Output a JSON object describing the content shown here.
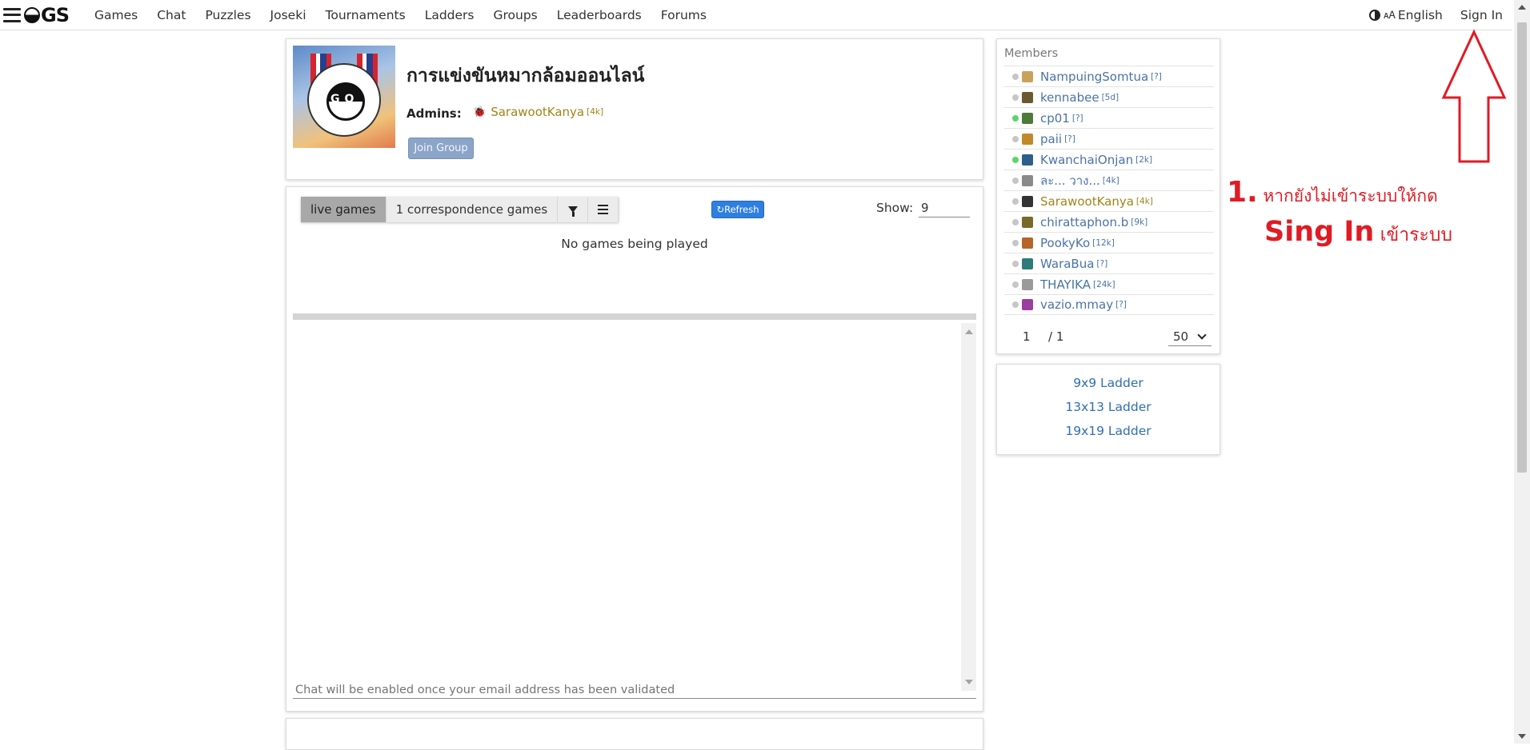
{
  "nav": {
    "logo_text": "GS",
    "links": [
      "Games",
      "Chat",
      "Puzzles",
      "Joseki",
      "Tournaments",
      "Ladders",
      "Groups",
      "Leaderboards",
      "Forums"
    ],
    "language": "English",
    "sign_in": "Sign In"
  },
  "group": {
    "title": "การแข่งขันหมากล้อมออนไลน์",
    "admins_label": "Admins:",
    "admin_name": "SarawootKanya",
    "admin_rank": "[4k]",
    "join_label": "Join Group"
  },
  "games": {
    "tab_live": "live games",
    "tab_correspondence": "1 correspondence games",
    "refresh_label": "Refresh",
    "show_label": "Show:",
    "show_value": "9",
    "empty_text": "No games being played",
    "chat_placeholder": "Chat will be enabled once your email address has been validated"
  },
  "members": {
    "title": "Members",
    "list": [
      {
        "name": "NampuingSomtua",
        "rank": "[?]",
        "online": false,
        "avatar_color": "#c9a25a"
      },
      {
        "name": "kennabee",
        "rank": "[5d]",
        "online": false,
        "avatar_color": "#6b5a2f"
      },
      {
        "name": "cp01",
        "rank": "[?]",
        "online": true,
        "avatar_color": "#4e7a3a"
      },
      {
        "name": "paii",
        "rank": "[?]",
        "online": false,
        "avatar_color": "#c08a2b"
      },
      {
        "name": "KwanchaiOnjan",
        "rank": "[2k]",
        "online": true,
        "avatar_color": "#2d5f8a"
      },
      {
        "name": "ละ... วาง...",
        "rank": "[4k]",
        "online": false,
        "avatar_color": "#8a8a8a"
      },
      {
        "name": "SarawootKanya",
        "rank": "[4k]",
        "online": false,
        "avatar_color": "#333333",
        "gold": true
      },
      {
        "name": "chirattaphon.b",
        "rank": "[9k]",
        "online": false,
        "avatar_color": "#7a6a2a"
      },
      {
        "name": "PookyKo",
        "rank": "[12k]",
        "online": false,
        "avatar_color": "#b5652b"
      },
      {
        "name": "WaraBua",
        "rank": "[?]",
        "online": false,
        "avatar_color": "#2f7a7a"
      },
      {
        "name": "THAYIKA",
        "rank": "[24k]",
        "online": false,
        "avatar_color": "#9a9a9a"
      },
      {
        "name": "vazio.mmay",
        "rank": "[?]",
        "online": false,
        "avatar_color": "#9a3fa0"
      }
    ],
    "page_current": "1",
    "page_total": "/ 1",
    "per_page": "50"
  },
  "ladders": [
    "9x9 Ladder",
    "13x13 Ladder",
    "19x19 Ladder"
  ],
  "annotation": {
    "step_number": "1.",
    "line1_text": "หากยังไม่เข้าระบบให้กด",
    "line2_bold": "Sing In",
    "line2_text": "เข้าระบบ",
    "color": "#e01b24"
  }
}
